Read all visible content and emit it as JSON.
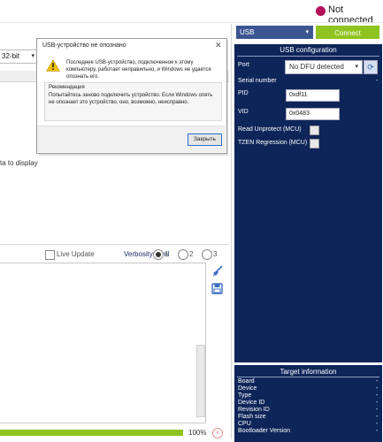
{
  "status": {
    "text": "Not connected",
    "dot_color": "#b5115a"
  },
  "left": {
    "bits_select": "32-bit",
    "no_data_text": "ta to display"
  },
  "log": {
    "live_update_label": "Live Update",
    "verbosity_label": "Verbosity level",
    "levels": [
      "1",
      "2",
      "3"
    ],
    "selected_level": "1",
    "progress_percent": 100,
    "progress_text": "100%"
  },
  "toolbar": {
    "interface_value": "USB",
    "connect_label": "Connect"
  },
  "usb_config": {
    "title": "USB configuration",
    "port_label": "Port",
    "port_value": "No DFU detected",
    "serial_label": "Serial number",
    "serial_value": "-",
    "pid_label": "PID",
    "pid_value": "0xdf11",
    "vid_label": "VID",
    "vid_value": "0x0483",
    "read_unprotect_label": "Read Unprotect (MCU)",
    "tzen_label": "TZEN Regression (MCU)"
  },
  "target_info": {
    "title": "Target information",
    "rows": [
      {
        "key": "Board",
        "value": "-"
      },
      {
        "key": "Device",
        "value": "-"
      },
      {
        "key": "Type",
        "value": "-"
      },
      {
        "key": "Device ID",
        "value": "-"
      },
      {
        "key": "Revision ID",
        "value": "-"
      },
      {
        "key": "Flash size",
        "value": "-"
      },
      {
        "key": "CPU",
        "value": "-"
      },
      {
        "key": "Bootloader Version",
        "value": "-"
      }
    ]
  },
  "dialog": {
    "title": "USB-устройство не опознано",
    "close_glyph": "✕",
    "message": "Последнее USB-устройство, подключенное к этому компьютеру, работает неправильно, и Windows не удается опознать его.",
    "recommendation_title": "Рекомендация",
    "recommendation_text": "Попытайтесь заново подключить устройство. Если Windows опять не опознает это устройство, оно, возможно, неисправно.",
    "ok_label": "Закрыть"
  },
  "colors": {
    "navy": "#0e2559",
    "accent_green": "#8fc31f",
    "select_blue": "#3c5591"
  }
}
